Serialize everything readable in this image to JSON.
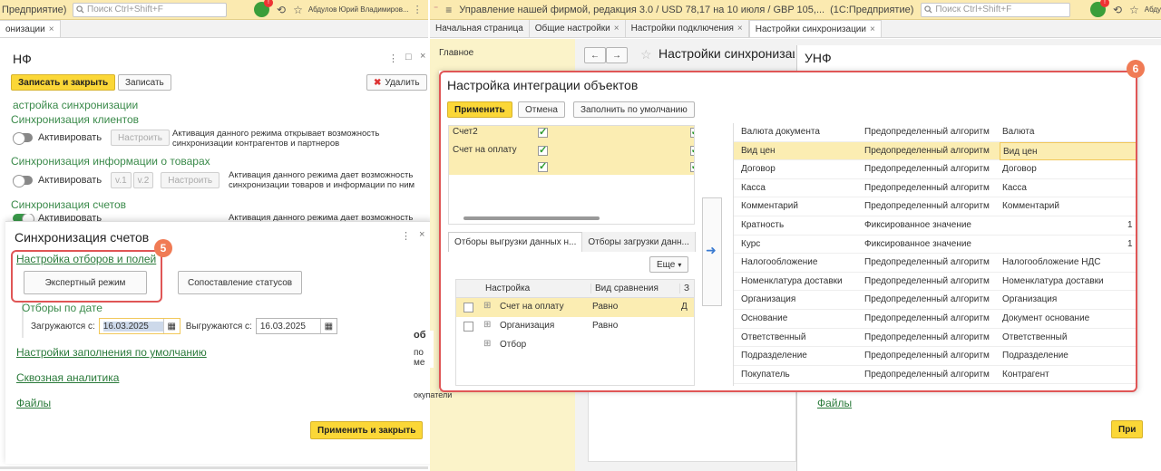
{
  "left": {
    "topbar_title": "Предприятие)",
    "search_placeholder": "Поиск Ctrl+Shift+F",
    "user_name": "Абдулов Юрий Владимиров...",
    "tab_label": "онизации",
    "form_title": "НФ",
    "save_close": "Записать и закрыть",
    "save": "Записать",
    "delete": "Удалить",
    "heading_settings": "астройка синхронизации",
    "sync_clients": "Синхронизация клиентов",
    "activate": "Активировать",
    "configure": "Настроить",
    "clients_desc": "Активация данного режима открывает возможность синхронизации контрагентов и партнеров",
    "sync_goods": "Синхронизация информации о товарах",
    "v1": "v.1",
    "v2": "v.2",
    "goods_desc": "Активация данного режима дает возможность синхронизации товаров и информации по ним",
    "sync_invoices": "Синхронизация счетов",
    "invoices_desc": "Активация данного режима дает возможность"
  },
  "dialog": {
    "title": "Синхронизация счетов",
    "badge": "5",
    "filter_link": "Настройка отборов и полей",
    "expert_mode": "Экспертный режим",
    "status_map": "Сопоставление статусов",
    "filters_by_date": "Отборы по дате",
    "loaded_from_label": "Загружаются с:",
    "loaded_from": "16.03.2025",
    "unloaded_from_label": "Выгружаются с:",
    "unloaded_from": "16.03.2025",
    "defaults_link": "Настройки заполнения по умолчанию",
    "analytics_link": "Сквозная аналитика",
    "files_link": "Файлы",
    "apply_close": "Применить и закрыть"
  },
  "right": {
    "topbar_title": "Управление нашей фирмой, редакция 3.0 / USD 78,17 на 10 июля / GBP 105,...",
    "topbar_platform": "(1С:Предприятие)",
    "search_placeholder": "Поиск Ctrl+Shift+F",
    "user_short": "Абду",
    "tabs": [
      {
        "label": "Начальная страница"
      },
      {
        "label": "Общие настройки"
      },
      {
        "label": "Настройки подключения"
      },
      {
        "label": "Настройки синхронизации"
      }
    ],
    "side_main": "Главное",
    "page_title": "Настройки синхронизаци",
    "unf_title": "УНФ",
    "bg_files": "Файлы",
    "bg_apply": "При",
    "bg_frag1": "об",
    "bg_frag2": "по",
    "bg_frag3": "ме",
    "bg_frag4": "окупатели"
  },
  "integration": {
    "title": "Настройка интеграции объектов",
    "badge": "6",
    "apply": "Применить",
    "cancel": "Отмена",
    "fill_default": "Заполнить по умолчанию",
    "objects": [
      {
        "name": "Счет2"
      },
      {
        "name": "Счет на оплату"
      },
      {
        "name": ""
      }
    ],
    "subtab1": "Отборы выгрузки данных н...",
    "subtab2": "Отборы загрузки данн...",
    "more": "Еще",
    "filter_headers": {
      "setting": "Настройка",
      "comparison": "Вид сравнения",
      "value": "З"
    },
    "filters": [
      {
        "setting": "Счет на оплату",
        "comparison": "Равно",
        "value": "Д"
      },
      {
        "setting": "Организация",
        "comparison": "Равно",
        "value": ""
      },
      {
        "setting": "Отбор",
        "comparison": "",
        "value": ""
      }
    ],
    "fields": [
      {
        "field": "Валюта документа",
        "method": "Предопределенный алгоритм",
        "value": "Валюта",
        "extra": ""
      },
      {
        "field": "Вид цен",
        "method": "Предопределенный алгоритм",
        "value": "Вид цен",
        "extra": ""
      },
      {
        "field": "Договор",
        "method": "Предопределенный алгоритм",
        "value": "Договор",
        "extra": ""
      },
      {
        "field": "Касса",
        "method": "Предопределенный алгоритм",
        "value": "Касса",
        "extra": ""
      },
      {
        "field": "Комментарий",
        "method": "Предопределенный алгоритм",
        "value": "Комментарий",
        "extra": ""
      },
      {
        "field": "Кратность",
        "method": "Фиксированное значение",
        "value": "",
        "extra": "1"
      },
      {
        "field": "Курс",
        "method": "Фиксированное значение",
        "value": "",
        "extra": "1"
      },
      {
        "field": "Налогообложение",
        "method": "Предопределенный алгоритм",
        "value": "Налогообложение НДС",
        "extra": ""
      },
      {
        "field": "Номенклатура доставки",
        "method": "Предопределенный алгоритм",
        "value": "Номенклатура доставки",
        "extra": ""
      },
      {
        "field": "Организация",
        "method": "Предопределенный алгоритм",
        "value": "Организация",
        "extra": ""
      },
      {
        "field": "Основание",
        "method": "Предопределенный алгоритм",
        "value": "Документ основание",
        "extra": ""
      },
      {
        "field": "Ответственный",
        "method": "Предопределенный алгоритм",
        "value": "Ответственный",
        "extra": ""
      },
      {
        "field": "Подразделение",
        "method": "Предопределенный алгоритм",
        "value": "Подразделение",
        "extra": ""
      },
      {
        "field": "Покупатель",
        "method": "Предопределенный алгоритм",
        "value": "Контрагент",
        "extra": ""
      }
    ]
  }
}
